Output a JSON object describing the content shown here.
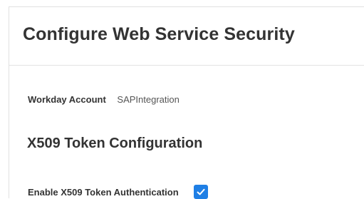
{
  "header": {
    "title": "Configure Web Service Security"
  },
  "account": {
    "label": "Workday Account",
    "value": "SAPIntegration"
  },
  "x509": {
    "section_title": "X509 Token Configuration",
    "enable_label": "Enable X509 Token Authentication",
    "enabled": true,
    "checkbox_color": "#1f7fe5",
    "check_icon": "check-icon"
  }
}
